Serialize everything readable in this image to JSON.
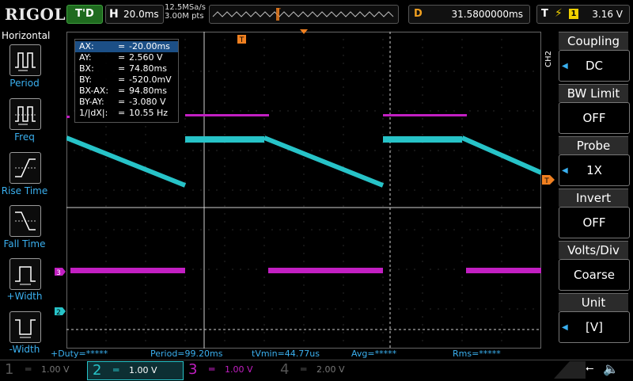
{
  "header": {
    "brand": "RIGOL",
    "run_state": "T'D",
    "horizontal": {
      "key": "H",
      "timebase": "20.0ms"
    },
    "sample_rate": "12.5MSa/s",
    "memory_depth": "3.00M pts",
    "delay": {
      "key": "D",
      "value": "31.5800000ms"
    },
    "trigger": {
      "key": "T",
      "source": "1",
      "level": "3.16 V"
    }
  },
  "left_menu": {
    "title": "Horizontal",
    "items": [
      {
        "label": "Period",
        "icon": "period-icon"
      },
      {
        "label": "Freq",
        "icon": "frequency-icon"
      },
      {
        "label": "Rise Time",
        "icon": "rise-time-icon"
      },
      {
        "label": "Fall Time",
        "icon": "fall-time-icon"
      },
      {
        "label": "+Width",
        "icon": "positive-width-icon"
      },
      {
        "label": "-Width",
        "icon": "negative-width-icon"
      }
    ]
  },
  "cursor_readout": {
    "rows": [
      {
        "name": "AX:",
        "value": "-20.00ms"
      },
      {
        "name": "AY:",
        "value": "2.560 V"
      },
      {
        "name": "BX:",
        "value": "74.80ms"
      },
      {
        "name": "BY:",
        "value": "-520.0mV"
      },
      {
        "name": "BX-AX:",
        "value": "94.80ms"
      },
      {
        "name": "BY-AY:",
        "value": "-3.080 V"
      },
      {
        "name": "1/|dX|:",
        "value": "10.55 Hz"
      }
    ],
    "equals": "="
  },
  "right_menu": {
    "channel_tag": "CH2",
    "items": [
      {
        "title": "Coupling",
        "value": "DC"
      },
      {
        "title": "BW Limit",
        "value": "OFF"
      },
      {
        "title": "Probe",
        "value": "1X"
      },
      {
        "title": "Invert",
        "value": "OFF"
      },
      {
        "title": "Volts/Div",
        "value": "Coarse"
      },
      {
        "title": "Unit",
        "value": "[V]"
      }
    ]
  },
  "measurements": {
    "pos_duty": "+Duty=*****",
    "period": "Period=99.20ms",
    "tvmin": "tVmin=44.77us",
    "avg": "Avg=*****",
    "rms": "Rms=*****"
  },
  "markers": {
    "ch3": "3",
    "ch2": "2",
    "trigger": "T"
  },
  "channels": [
    {
      "num": "1",
      "scale": "1.00 V",
      "color": "#f0d000",
      "active": false
    },
    {
      "num": "2",
      "scale": "1.00 V",
      "color": "#27c3c8",
      "active": true
    },
    {
      "num": "3",
      "scale": "1.00 V",
      "color": "#c21fc2",
      "active": false
    },
    {
      "num": "4",
      "scale": "2.00 V",
      "color": "#3a7fd6",
      "active": false
    }
  ],
  "colors": {
    "ch2": "#27c3c8",
    "ch3": "#c21fc2",
    "trigger": "#f08020",
    "accent": "#3ab0f0"
  }
}
